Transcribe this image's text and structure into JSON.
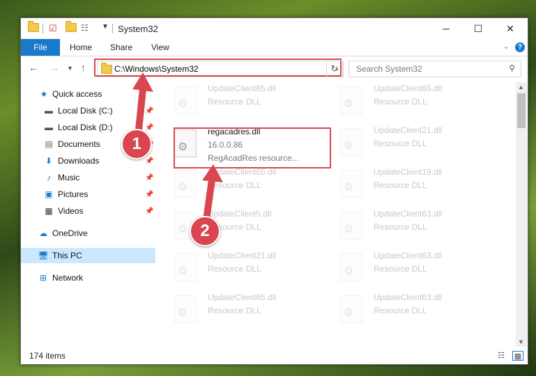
{
  "window": {
    "title": "System32",
    "controls": {
      "minimize": "─",
      "maximize": "☐",
      "close": "✕"
    }
  },
  "ribbon": {
    "tabs": [
      "File",
      "Home",
      "Share",
      "View"
    ],
    "help": "?"
  },
  "nav": {
    "address": "C:\\Windows\\System32",
    "search_placeholder": "Search System32"
  },
  "sidebar": {
    "items": [
      {
        "label": "Quick access",
        "icon": "star-icon",
        "pinned": false
      },
      {
        "label": "Local Disk (C:)",
        "icon": "drive-icon",
        "pinned": true
      },
      {
        "label": "Local Disk (D:)",
        "icon": "drive-icon",
        "pinned": true
      },
      {
        "label": "Documents",
        "icon": "documents-icon",
        "pinned": true
      },
      {
        "label": "Downloads",
        "icon": "download-icon",
        "pinned": true
      },
      {
        "label": "Music",
        "icon": "music-icon",
        "pinned": true
      },
      {
        "label": "Pictures",
        "icon": "pictures-icon",
        "pinned": true
      },
      {
        "label": "Videos",
        "icon": "video-icon",
        "pinned": true
      },
      {
        "label": "OneDrive",
        "icon": "cloud-icon",
        "pinned": false
      },
      {
        "label": "This PC",
        "icon": "computer-icon",
        "pinned": false,
        "selected": true
      },
      {
        "label": "Network",
        "icon": "network-icon",
        "pinned": false
      }
    ]
  },
  "files": {
    "left": [
      {
        "name": "UpdateClient65.dll",
        "type": "Resource DLL"
      },
      {
        "name": "regacadres.dll",
        "version": "16.0.0.86",
        "desc": "RegAcadRes resource..."
      },
      {
        "name": "UpdateClient65.dll",
        "type": "Resource DLL"
      },
      {
        "name": "UpdateClient5.dll",
        "type": "Resource DLL"
      },
      {
        "name": "UpdateClient21.dll",
        "type": "Resource DLL"
      },
      {
        "name": "UpdateClient65.dll",
        "type": "Resource DLL"
      }
    ],
    "right": [
      {
        "name": "UpdateClient65.dll",
        "type": "Resource DLL"
      },
      {
        "name": "UpdateClient21.dll",
        "type": "Resource DLL"
      },
      {
        "name": "UpdateClient19.dll",
        "type": "Resource DLL"
      },
      {
        "name": "UpdateClient63.dll",
        "type": "Resource DLL"
      },
      {
        "name": "UpdateClient63.dll",
        "type": "Resource DLL"
      },
      {
        "name": "UpdateClient63.dll",
        "type": "Resource DLL"
      }
    ]
  },
  "status": {
    "count": "174 items"
  },
  "callouts": [
    "1",
    "2"
  ],
  "colors": {
    "accent": "#1979ca",
    "highlight": "#d9464f"
  }
}
